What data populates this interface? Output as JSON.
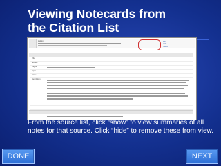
{
  "slide": {
    "title_line1": "Viewing Notecards from",
    "title_line2": "the Citation List",
    "caption": "From the source list, click “show” to view summaries of all notes for that source.  Click “hide” to remove these from view."
  },
  "screenshot": {
    "top_row_text": "Hutton",
    "links": [
      "Edit",
      "Hide",
      "Notes"
    ],
    "fields": [
      {
        "label": "Title",
        "value": ""
      },
      {
        "label": "Subject",
        "value": ""
      },
      {
        "label": "Pages",
        "value": ""
      },
      {
        "label": "Topic",
        "value": ""
      },
      {
        "label": "Notes",
        "value": ""
      },
      {
        "label": "Description",
        "value": ""
      }
    ]
  },
  "nav": {
    "done_label": "DONE",
    "next_label": "NEXT"
  },
  "colors": {
    "background": "#13308f",
    "title_text": "#ffffff",
    "button": "#3b7fe0",
    "highlight_circle": "#d03030"
  }
}
